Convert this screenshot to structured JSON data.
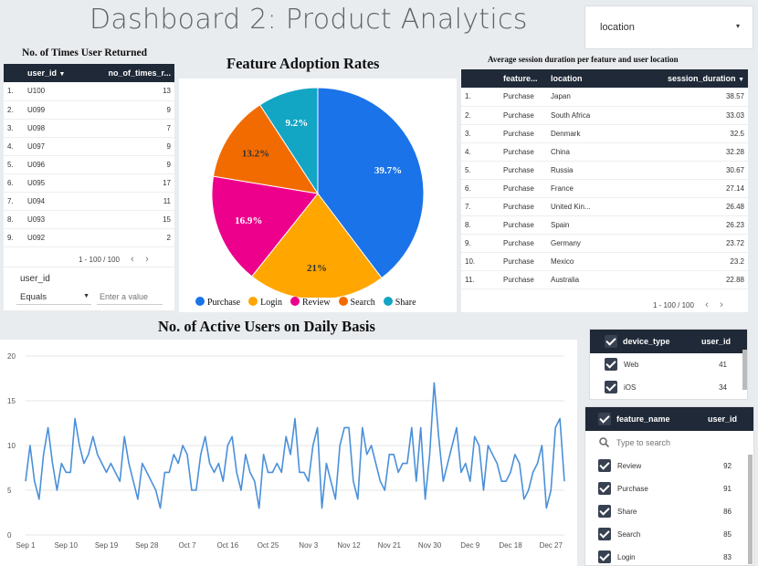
{
  "page": {
    "title": "Dashboard 2: Product Analytics"
  },
  "location_control": {
    "label": "location",
    "arrow": "▾"
  },
  "returned_table": {
    "title": "No. of Times User Returned",
    "columns": [
      "user_id",
      "no_of_times_r..."
    ],
    "rows": [
      {
        "idx": "1.",
        "user_id": "U100",
        "value": "13"
      },
      {
        "idx": "2.",
        "user_id": "U099",
        "value": "9"
      },
      {
        "idx": "3.",
        "user_id": "U098",
        "value": "7"
      },
      {
        "idx": "4.",
        "user_id": "U097",
        "value": "9"
      },
      {
        "idx": "5.",
        "user_id": "U096",
        "value": "9"
      },
      {
        "idx": "6.",
        "user_id": "U095",
        "value": "17"
      },
      {
        "idx": "7.",
        "user_id": "U094",
        "value": "11"
      },
      {
        "idx": "8.",
        "user_id": "U093",
        "value": "15"
      },
      {
        "idx": "9.",
        "user_id": "U092",
        "value": "2"
      }
    ],
    "pager": "1 - 100 / 100"
  },
  "user_filter": {
    "field": "user_id",
    "operator": "Equals",
    "placeholder": "Enter a value"
  },
  "pie": {
    "title": "Feature Adoption Rates",
    "legend": [
      {
        "name": "Purchase",
        "color": "#1a73e8"
      },
      {
        "name": "Login",
        "color": "#ffa600"
      },
      {
        "name": "Review",
        "color": "#ec008c"
      },
      {
        "name": "Search",
        "color": "#f26b00"
      },
      {
        "name": "Share",
        "color": "#12a5c4"
      }
    ]
  },
  "session_table": {
    "title": "Average session duration per feature and user location",
    "columns": [
      "feature...",
      "location",
      "session_duration"
    ],
    "rows": [
      {
        "idx": "1.",
        "feature": "Purchase",
        "location": "Japan",
        "value": "38.57"
      },
      {
        "idx": "2.",
        "feature": "Purchase",
        "location": "South Africa",
        "value": "33.03"
      },
      {
        "idx": "3.",
        "feature": "Purchase",
        "location": "Denmark",
        "value": "32.5"
      },
      {
        "idx": "4.",
        "feature": "Purchase",
        "location": "China",
        "value": "32.28"
      },
      {
        "idx": "5.",
        "feature": "Purchase",
        "location": "Russia",
        "value": "30.67"
      },
      {
        "idx": "6.",
        "feature": "Purchase",
        "location": "France",
        "value": "27.14"
      },
      {
        "idx": "7.",
        "feature": "Purchase",
        "location": "United Kin...",
        "value": "26.48"
      },
      {
        "idx": "8.",
        "feature": "Purchase",
        "location": "Spain",
        "value": "26.23"
      },
      {
        "idx": "9.",
        "feature": "Purchase",
        "location": "Germany",
        "value": "23.72"
      },
      {
        "idx": "10.",
        "feature": "Purchase",
        "location": "Mexico",
        "value": "23.2"
      },
      {
        "idx": "11.",
        "feature": "Purchase",
        "location": "Australia",
        "value": "22.88"
      }
    ],
    "pager": "1 - 100 / 100"
  },
  "device_filter": {
    "columns": [
      "device_type",
      "user_id"
    ],
    "rows": [
      {
        "name": "Web",
        "count": "41"
      },
      {
        "name": "iOS",
        "count": "34"
      }
    ]
  },
  "feature_filter": {
    "columns": [
      "feature_name",
      "user_id"
    ],
    "search_placeholder": "Type to search",
    "rows": [
      {
        "name": "Review",
        "count": "92"
      },
      {
        "name": "Purchase",
        "count": "91"
      },
      {
        "name": "Share",
        "count": "86"
      },
      {
        "name": "Search",
        "count": "85"
      },
      {
        "name": "Login",
        "count": "83"
      }
    ]
  },
  "chart_data": [
    {
      "type": "pie",
      "title": "Feature Adoption Rates",
      "categories": [
        "Purchase",
        "Login",
        "Review",
        "Search",
        "Share"
      ],
      "values": [
        39.7,
        21,
        16.9,
        13.2,
        9.2
      ],
      "labels": [
        "39.7%",
        "21%",
        "16.9%",
        "13.2%",
        "9.2%"
      ],
      "colors": [
        "#1a73e8",
        "#ffa600",
        "#ec008c",
        "#f26b00",
        "#12a5c4"
      ],
      "legend": "bottom"
    },
    {
      "type": "line",
      "title": "No. of Active Users on Daily Basis",
      "color": "#4a90d9",
      "x_start": "Sep 1",
      "x_ticks": [
        "Sep 1",
        "Sep 10",
        "Sep 19",
        "Sep 28",
        "Oct 7",
        "Oct 16",
        "Oct 25",
        "Nov 3",
        "Nov 12",
        "Nov 21",
        "Nov 30",
        "Dec 9",
        "Dec 18",
        "Dec 27"
      ],
      "y_ticks": [
        "0",
        "5",
        "10",
        "15",
        "20"
      ],
      "ylim": [
        0,
        20
      ],
      "grid": true,
      "values": [
        6,
        10,
        6,
        4,
        9,
        12,
        8,
        5,
        8,
        7,
        7,
        13,
        10,
        8,
        9,
        11,
        9,
        8,
        7,
        8,
        7,
        6,
        11,
        8,
        6,
        4,
        8,
        7,
        6,
        5,
        3,
        7,
        7,
        9,
        8,
        10,
        9,
        5,
        5,
        9,
        11,
        8,
        7,
        8,
        6,
        10,
        11,
        7,
        5,
        9,
        7,
        6,
        3,
        9,
        7,
        7,
        8,
        7,
        11,
        9,
        13,
        7,
        7,
        6,
        10,
        12,
        3,
        8,
        6,
        4,
        10,
        12,
        12,
        6,
        4,
        12,
        9,
        10,
        8,
        6,
        5,
        9,
        9,
        7,
        8,
        8,
        12,
        6,
        12,
        4,
        9,
        17,
        11,
        6,
        8,
        10,
        12,
        7,
        8,
        6,
        11,
        10,
        5,
        10,
        9,
        8,
        6,
        6,
        7,
        9,
        8,
        4,
        5,
        7,
        8,
        10,
        3,
        5,
        12,
        13,
        6
      ]
    }
  ]
}
